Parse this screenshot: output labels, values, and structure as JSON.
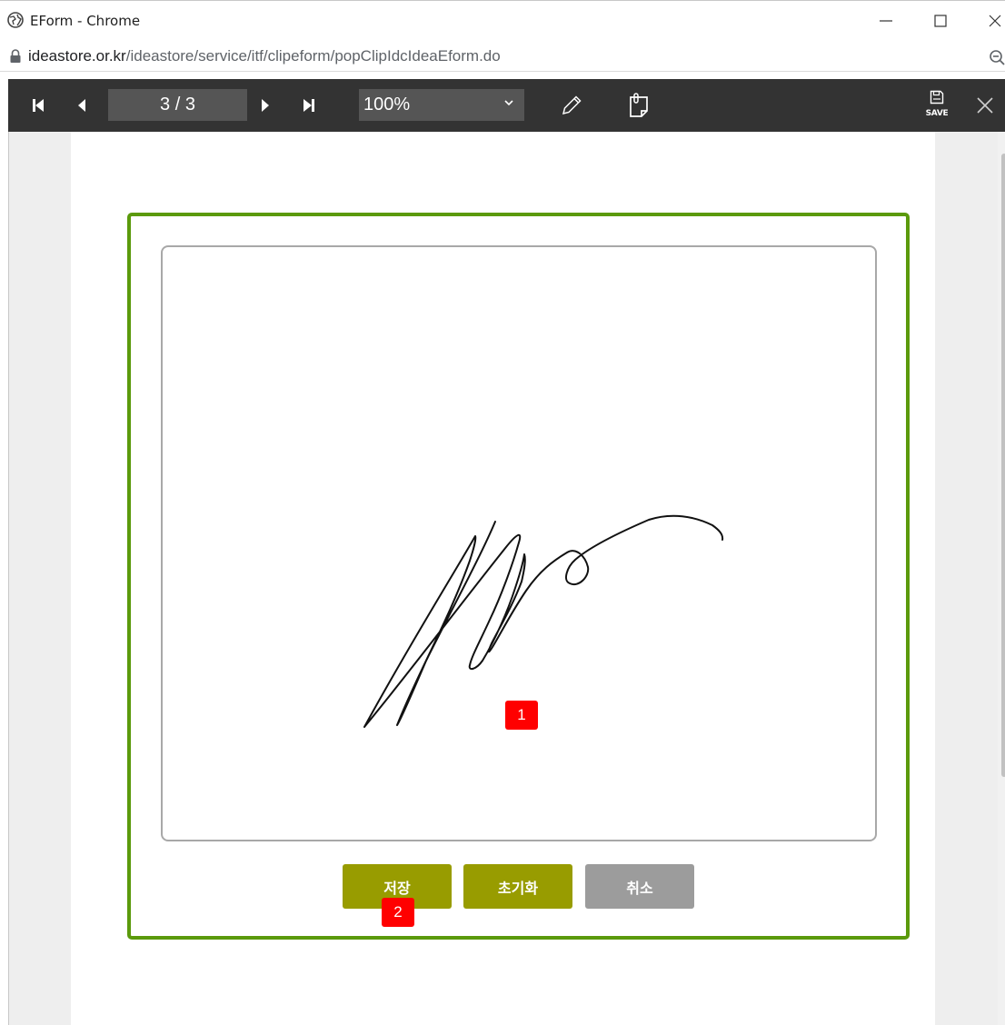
{
  "window": {
    "title": "EForm - Chrome",
    "minimize_icon": "minimize-icon",
    "maximize_icon": "maximize-icon",
    "close_icon": "close-icon"
  },
  "address_bar": {
    "domain": "ideastore.or.kr",
    "path": "/ideastore/service/itf/clipeform/popClipIdcIdeaEform.do"
  },
  "toolbar": {
    "page_indicator": "3 / 3",
    "zoom_value": "100%",
    "save_label": "SAVE",
    "icons": [
      "first-page-icon",
      "prev-page-icon",
      "next-page-icon",
      "last-page-icon",
      "pencil-icon",
      "memo-icon",
      "save-icon",
      "close-icon"
    ]
  },
  "signature": {
    "buttons": {
      "save": "저장",
      "reset": "초기화",
      "cancel": "취소"
    }
  },
  "markers": {
    "one": "1",
    "two": "2"
  },
  "colors": {
    "panel_border": "#5b9a0c",
    "button_olive": "#989c00",
    "button_gray": "#9c9c9c",
    "toolbar": "#333333",
    "marker": "#ff0000"
  }
}
